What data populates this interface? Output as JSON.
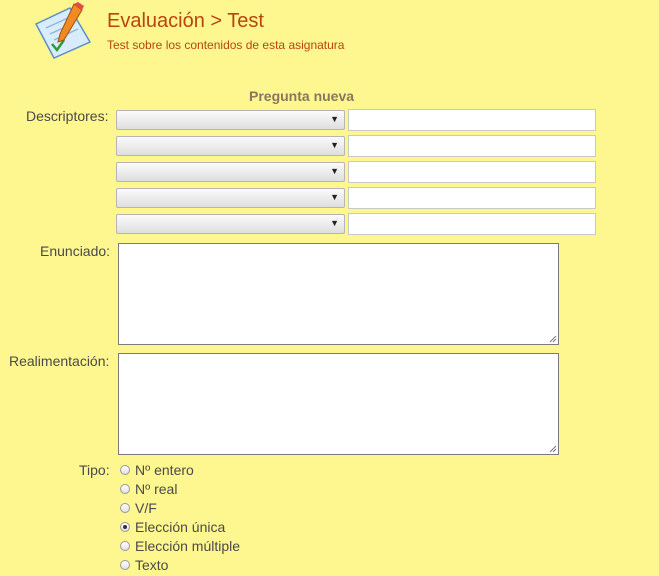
{
  "header": {
    "title": "Evaluación > Test",
    "subtitle": "Test sobre los contenidos de esta asignatura",
    "logo_icon": "test-pencil-icon"
  },
  "form": {
    "title": "Pregunta nueva",
    "descriptors_label": "Descriptores:",
    "statement_label": "Enunciado:",
    "feedback_label": "Realimentación:",
    "type_label": "Tipo:",
    "descriptor_rows": [
      {
        "select_value": "",
        "text_value": ""
      },
      {
        "select_value": "",
        "text_value": ""
      },
      {
        "select_value": "",
        "text_value": ""
      },
      {
        "select_value": "",
        "text_value": ""
      },
      {
        "select_value": "",
        "text_value": ""
      }
    ],
    "statement_value": "",
    "feedback_value": "",
    "type_options": [
      {
        "label": "Nº entero",
        "checked": false
      },
      {
        "label": "Nº real",
        "checked": false
      },
      {
        "label": "V/F",
        "checked": false
      },
      {
        "label": "Elección única",
        "checked": true
      },
      {
        "label": "Elección múltiple",
        "checked": false
      },
      {
        "label": "Texto",
        "checked": false
      }
    ]
  },
  "colors": {
    "background": "#fef68e",
    "title": "#b8450f",
    "form_title": "#8a7560"
  }
}
